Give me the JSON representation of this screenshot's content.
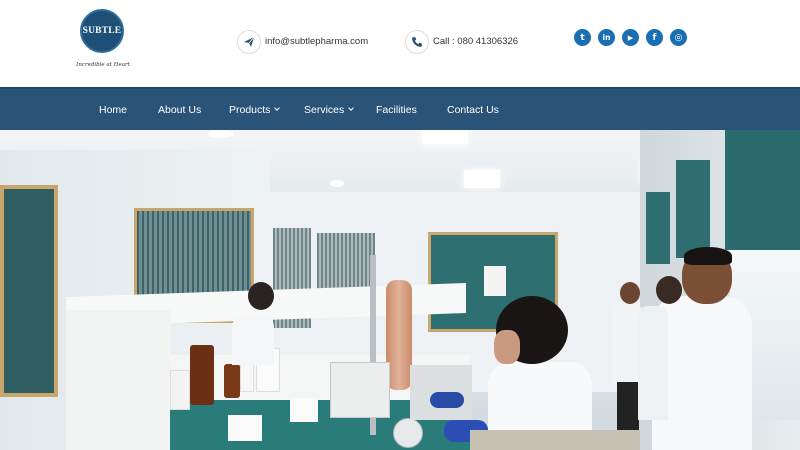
{
  "brand": {
    "logo_text": "SUBTLE",
    "tagline": "Incredible at Heart"
  },
  "contact": {
    "email": "info@subtlepharma.com",
    "phone": "Call : 080 41306326"
  },
  "socials": [
    {
      "name": "twitter",
      "glyph": "t"
    },
    {
      "name": "linkedin",
      "glyph": "in"
    },
    {
      "name": "youtube",
      "glyph": "▶"
    },
    {
      "name": "facebook",
      "glyph": "f"
    },
    {
      "name": "instagram",
      "glyph": "◎"
    }
  ],
  "nav": {
    "items": [
      {
        "label": "Home"
      },
      {
        "label": "About Us"
      },
      {
        "label": "Products"
      },
      {
        "label": "Services"
      },
      {
        "label": "Facilities"
      },
      {
        "label": "Contact Us"
      }
    ]
  },
  "colors": {
    "nav_bg": "#2a5378",
    "social_bg": "#1a6fb3",
    "logo_bg": "#1d4f77"
  }
}
